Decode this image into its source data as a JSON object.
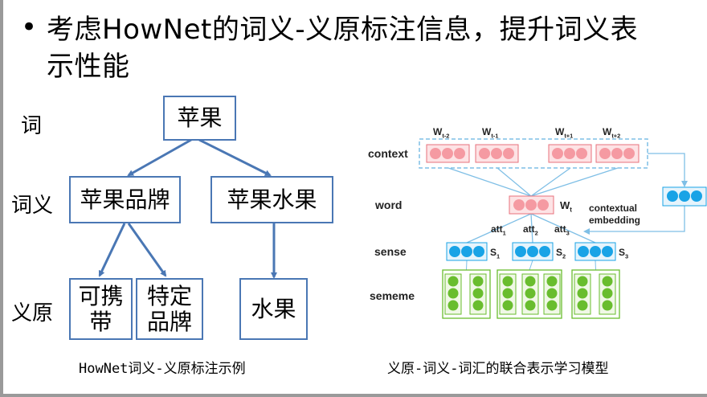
{
  "slide": {
    "bullet": "•",
    "heading": "考虑HowNet的词义-义原标注信息，提升词义表示性能"
  },
  "left_diagram": {
    "row_labels": {
      "word": "词",
      "sense": "词义",
      "sememe": "义原"
    },
    "nodes": {
      "root": "苹果",
      "sense_brand": "苹果品牌",
      "sense_fruit": "苹果水果",
      "sememe_portable": "可携带",
      "sememe_specific_brand": "特定品牌",
      "sememe_fruit": "水果"
    },
    "caption": "HowNet词义-义原标注示例"
  },
  "right_diagram": {
    "row_labels": {
      "context": "context",
      "word": "word",
      "sense": "sense",
      "sememe": "sememe"
    },
    "context_words": [
      "W_{t-2}",
      "W_{t-1}",
      "W_{t+1}",
      "W_{t+2}"
    ],
    "target_word": "W_t",
    "attention_labels": [
      "att_1",
      "att_2",
      "att_3"
    ],
    "sense_labels": [
      "S_1",
      "S_2",
      "S_3"
    ],
    "contextual_embedding_label": [
      "contextual",
      "embedding"
    ],
    "caption": "义原-词义-词汇的联合表示学习模型",
    "colors": {
      "pink": "#f59aa2",
      "pink_border": "#e8727c",
      "blue": "#19a3e6",
      "green": "#69bd2e",
      "dash": "#7fbfe6"
    }
  }
}
